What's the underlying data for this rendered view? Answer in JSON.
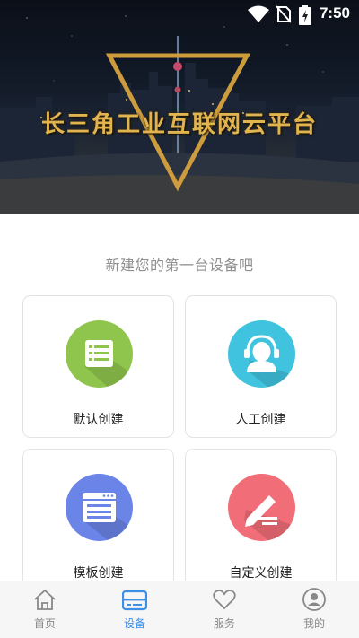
{
  "status_bar": {
    "time": "7:50",
    "icons": [
      "wifi-icon",
      "no-sim-icon",
      "battery-charging-icon"
    ]
  },
  "banner": {
    "title": "长三角工业互联网云平台"
  },
  "prompt": "新建您的第一台设备吧",
  "cards": [
    {
      "label": "默认创建",
      "icon": "list-document-icon",
      "color": "#8fc54d"
    },
    {
      "label": "人工创建",
      "icon": "customer-service-icon",
      "color": "#3fc3de"
    },
    {
      "label": "模板创建",
      "icon": "template-window-icon",
      "color": "#6b84e8"
    },
    {
      "label": "自定义创建",
      "icon": "pencil-edit-icon",
      "color": "#f16d78"
    }
  ],
  "tabbar": {
    "active": "设备",
    "items": [
      {
        "label": "首页",
        "icon": "home-icon"
      },
      {
        "label": "设备",
        "icon": "device-icon"
      },
      {
        "label": "服务",
        "icon": "heart-icon"
      },
      {
        "label": "我的",
        "icon": "user-profile-icon"
      }
    ],
    "active_color": "#3d8fe8",
    "inactive_color": "#888888"
  }
}
